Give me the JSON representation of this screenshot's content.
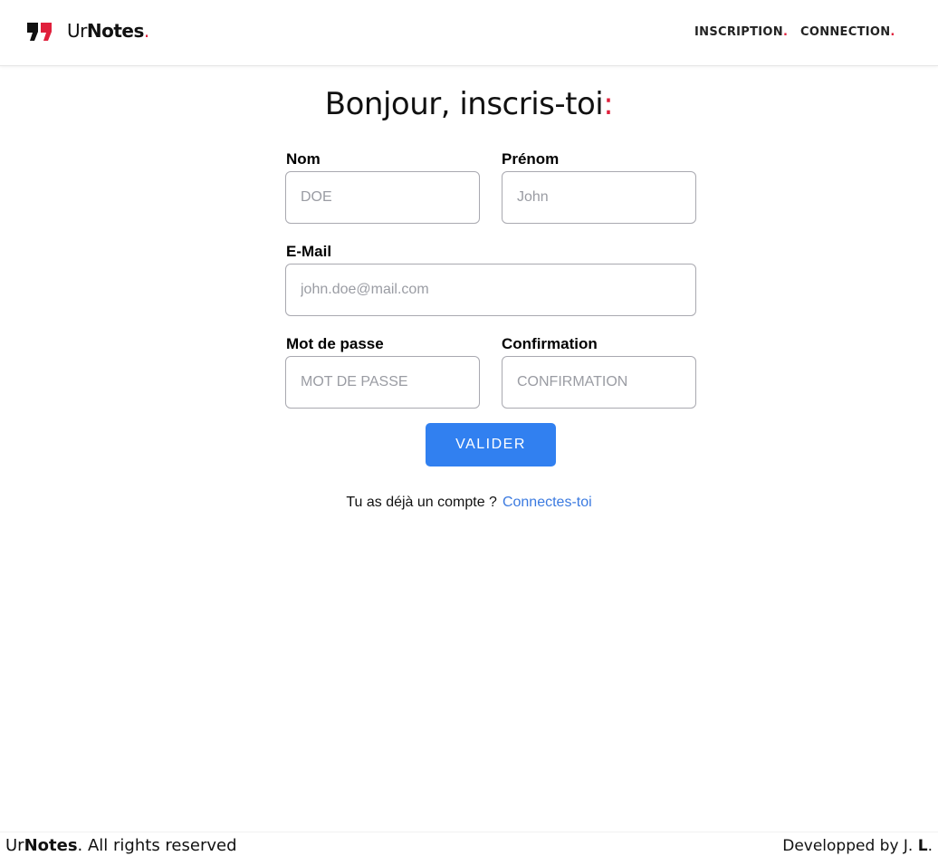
{
  "header": {
    "brand_prefix": "Ur",
    "brand_bold": "Notes",
    "brand_dot": ".",
    "nav": {
      "inscription": "INSCRIPTION",
      "connection": "CONNECTION",
      "dot": "."
    }
  },
  "title": {
    "text": "Bonjour, inscris-toi",
    "accent": ":"
  },
  "form": {
    "nom": {
      "label": "Nom",
      "placeholder": "DOE"
    },
    "prenom": {
      "label": "Prénom",
      "placeholder": "John"
    },
    "email": {
      "label": "E-Mail",
      "placeholder": "john.doe@mail.com"
    },
    "password": {
      "label": "Mot de passe",
      "placeholder": "MOT DE PASSE"
    },
    "confirmation": {
      "label": "Confirmation",
      "placeholder": "CONFIRMATION"
    },
    "submit_label": "VALIDER"
  },
  "signin": {
    "text": "Tu as déjà un compte ?",
    "link": "Connectes-toi"
  },
  "footer": {
    "left_prefix": "Ur",
    "left_bold": "Notes",
    "left_suffix": ". All rights reserved",
    "right_prefix": "Developped by J. ",
    "right_bold": "L",
    "right_suffix": "."
  },
  "colors": {
    "accent": "#e0203c",
    "primary": "#3180f0",
    "link": "#3b7ae0"
  },
  "icons": {
    "logo": "quote-mark-icon"
  }
}
